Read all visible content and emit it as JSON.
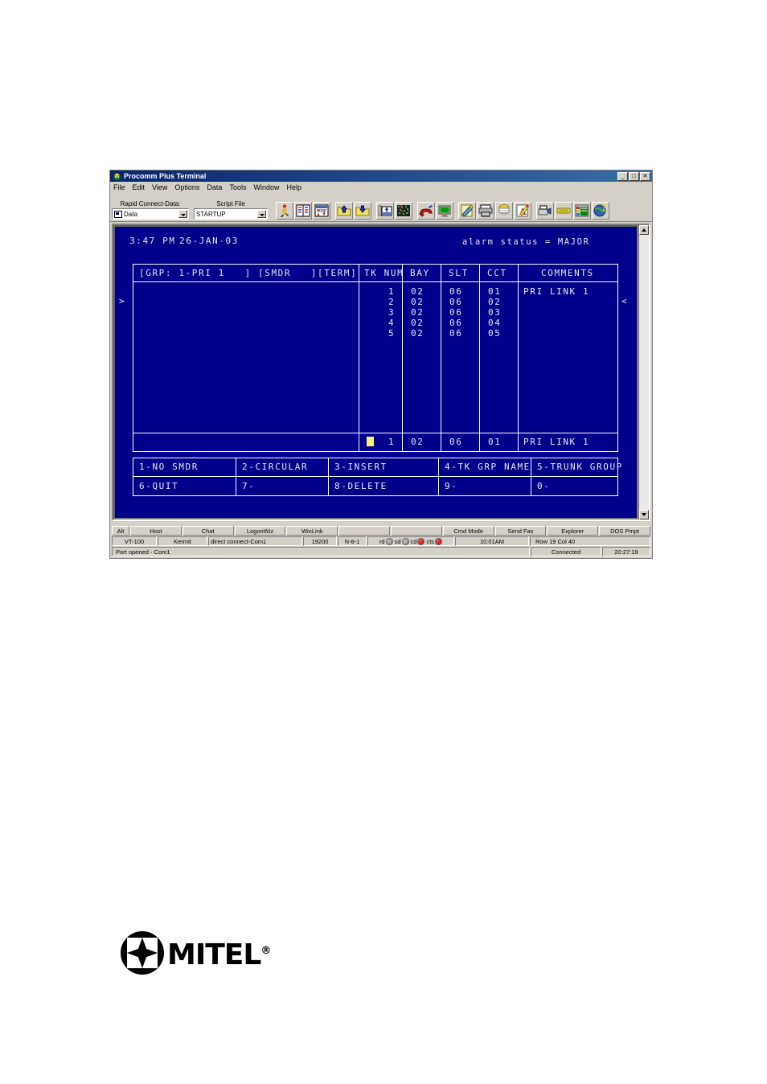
{
  "window": {
    "title": "Procomm Plus Terminal",
    "icon": "procomm-app-icon",
    "buttons": [
      {
        "name": "minimize",
        "glyph": "_"
      },
      {
        "name": "maximize",
        "glyph": "□"
      },
      {
        "name": "close",
        "glyph": "✕"
      }
    ]
  },
  "menu": {
    "items": [
      "File",
      "Edit",
      "View",
      "Options",
      "Data",
      "Tools",
      "Window",
      "Help"
    ]
  },
  "toolbar": {
    "rapid_connect": {
      "label": "Rapid Connect-Data:",
      "value": "Data"
    },
    "script_file": {
      "label": "Script File",
      "value": "STARTUP"
    },
    "icons": [
      "runner-icon",
      "phonebook-icon",
      "mode-icon",
      "upload-folder-icon",
      "download-folder-icon",
      "send-file-icon",
      "keyboard-map-icon",
      "hangup-phone-icon",
      "monitor-icon",
      "notepad-pencil-icon",
      "printer-icon",
      "capture-icon",
      "editor-icon",
      "fax-icon",
      "modem-icon",
      "setup-icon",
      "world-help-icon"
    ]
  },
  "terminal": {
    "time": "3:47 PM",
    "date": "26-JAN-03",
    "alarm_status": "alarm status = MAJOR",
    "left_marker": ">",
    "right_marker": "<",
    "form_header": "[GRP: 1-PRI 1   ] [SMDR   ][TERM]",
    "columns": [
      "TK NUM",
      "BAY",
      "SLT",
      "CCT",
      "COMMENTS"
    ],
    "rows": [
      {
        "tk_num": "1",
        "bay": "02",
        "slt": "06",
        "cct": "01",
        "comments": "PRI LINK 1"
      },
      {
        "tk_num": "2",
        "bay": "02",
        "slt": "06",
        "cct": "02",
        "comments": ""
      },
      {
        "tk_num": "3",
        "bay": "02",
        "slt": "06",
        "cct": "03",
        "comments": ""
      },
      {
        "tk_num": "4",
        "bay": "02",
        "slt": "06",
        "cct": "04",
        "comments": ""
      },
      {
        "tk_num": "5",
        "bay": "02",
        "slt": "06",
        "cct": "05",
        "comments": ""
      }
    ],
    "entry_row": {
      "cursor": true,
      "tk_num": "1",
      "bay": "02",
      "slt": "06",
      "cct": "01",
      "comments": "PRI LINK 1"
    },
    "softkeys_row1": [
      "1-NO SMDR",
      "2-CIRCULAR",
      "3-INSERT",
      "4-TK GRP NAME",
      "5-TRUNK GROUP"
    ],
    "softkeys_row2": [
      "6-QUIT",
      "7-",
      "8-DELETE",
      "9-",
      "0-"
    ],
    "colors": {
      "background": "#00008b",
      "text": "#e8e8e8",
      "cursor": "#f5f08a"
    }
  },
  "fnbar": {
    "alt": "Alt",
    "buttons": [
      "Host",
      "Chat",
      "LogonWiz",
      "WinLink",
      "",
      "",
      "Cmd Mode",
      "Send Fax",
      "Explorer",
      "DOS Pmpt"
    ]
  },
  "statusbar": {
    "emulation": "VT-100",
    "protocol": "Kermit",
    "connection": "direct connect-Com1",
    "baud": "19200",
    "params": "N-8-1",
    "leds": [
      {
        "label": "rd",
        "state": "grey"
      },
      {
        "label": "sd",
        "state": "grey"
      },
      {
        "label": "cd",
        "state": "red"
      },
      {
        "label": "cts",
        "state": "red"
      }
    ],
    "timer": "10:01AM",
    "cursor_pos": "Row 19   Col 40"
  },
  "statusbar2": {
    "message": "Port opened - Com1",
    "connected": "Connected",
    "elapsed": "20:27:19"
  },
  "footer": {
    "logo_text": "MITEL",
    "registered": "®"
  }
}
